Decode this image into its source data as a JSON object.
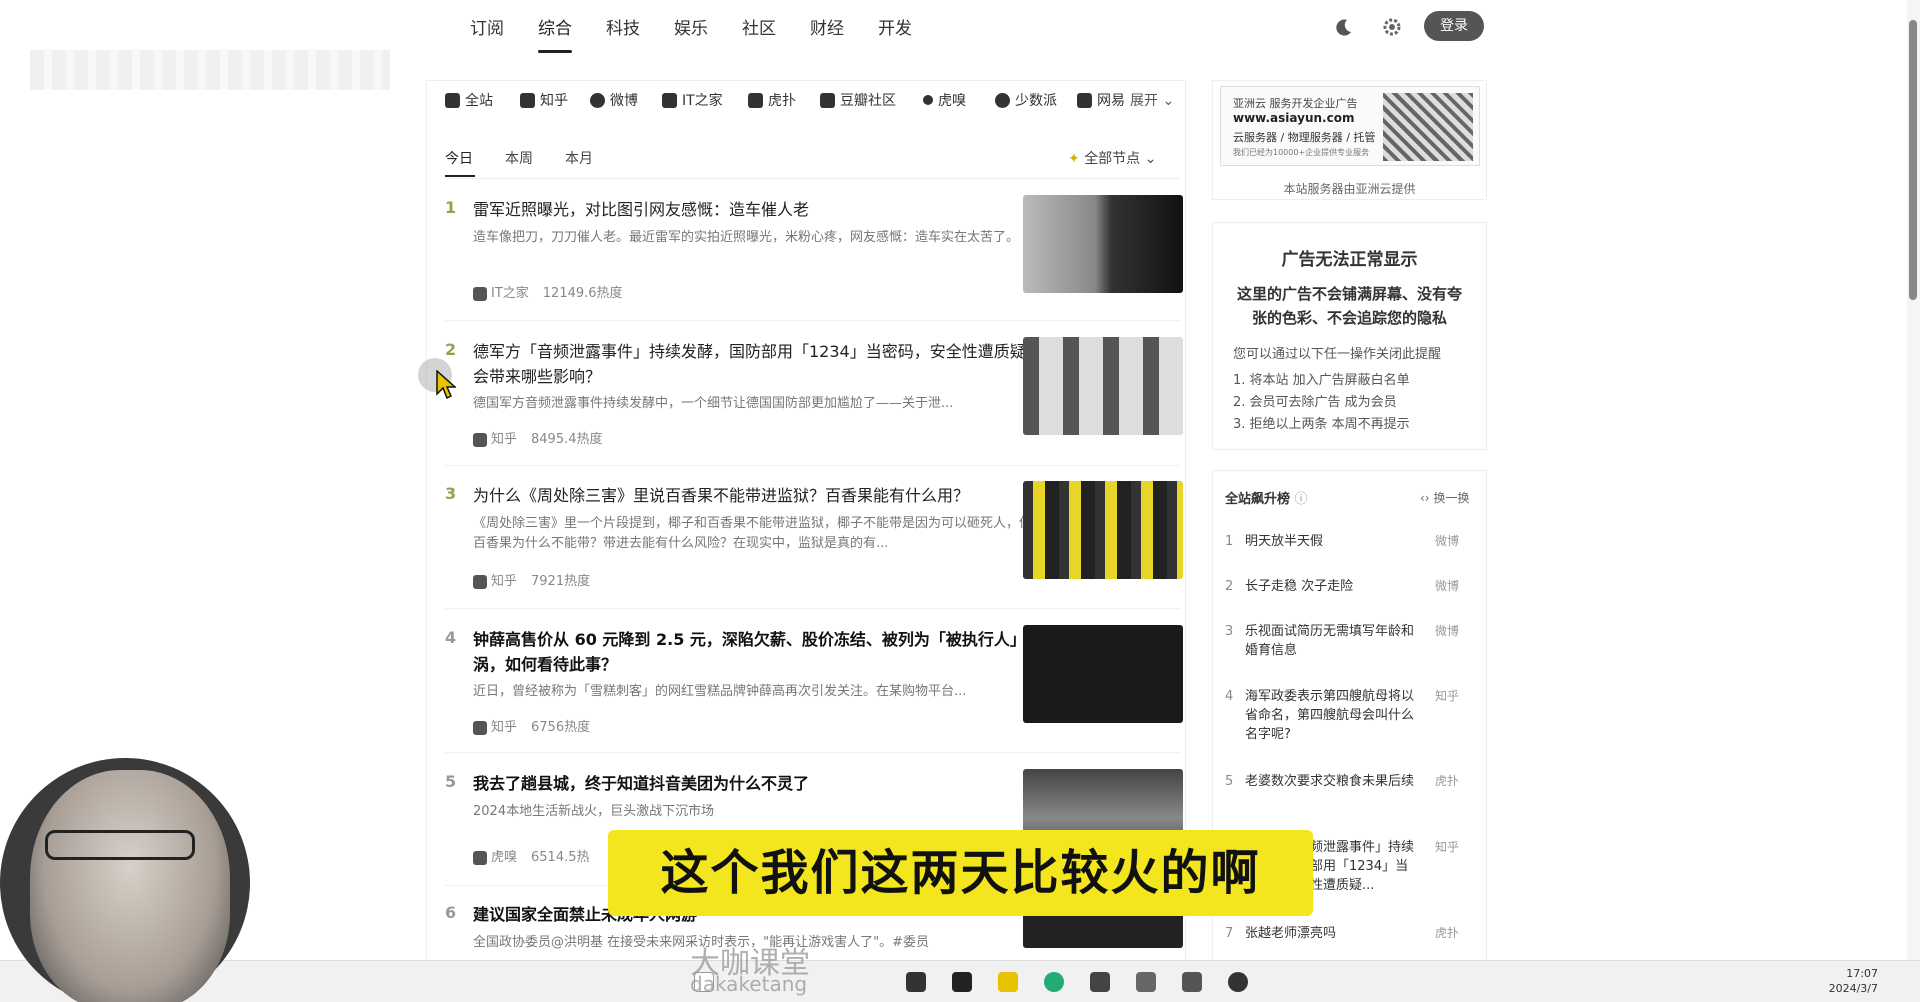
{
  "nav": {
    "tabs": [
      "订阅",
      "综合",
      "科技",
      "娱乐",
      "社区",
      "财经",
      "开发"
    ],
    "active_tab": "综合",
    "login_label": "登录"
  },
  "sources": {
    "items": [
      "全站",
      "知乎",
      "微博",
      "IT之家",
      "虎扑",
      "豆瓣社区",
      "虎嗅",
      "少数派",
      "网易"
    ],
    "expand_label": "展开"
  },
  "subtabs": {
    "items": [
      "今日",
      "本周",
      "本月"
    ],
    "active": "今日",
    "all_nodes_label": "全部节点"
  },
  "feed": [
    {
      "rank": "1",
      "title": "雷军近照曝光，对比图引网友感慨：造车催人老",
      "desc": "造车像把刀，刀刀催人老。最近雷军的实拍近照曝光，米粉心疼，网友感慨：造车实在太苦了。",
      "source": "IT之家",
      "heat": "12149.6热度"
    },
    {
      "rank": "2",
      "title": "德军方「音频泄露事件」持续发酵，国防部用「1234」当密码，安全性遭质疑，会带来哪些影响？",
      "desc": "德国军方音频泄露事件持续发酵中，一个细节让德国国防部更加尴尬了——关于泄...",
      "source": "知乎",
      "heat": "8495.4热度"
    },
    {
      "rank": "3",
      "title": "为什么《周处除三害》里说百香果不能带进监狱？百香果能有什么用？",
      "desc": "《周处除三害》里一个片段提到，椰子和百香果不能带进监狱，椰子不能带是因为可以砸死人，但百香果为什么不能带？带进去能有什么风险？在现实中，监狱是真的有...",
      "source": "知乎",
      "heat": "7921热度"
    },
    {
      "rank": "4",
      "title": "钟薛高售价从 60 元降到 2.5 元，深陷欠薪、股价冻结、被列为「被执行人」旋涡，如何看待此事？",
      "desc": "近日，曾经被称为「雪糕刺客」的网红雪糕品牌钟薛高再次引发关注。在某购物平台...",
      "source": "知乎",
      "heat": "6756热度"
    },
    {
      "rank": "5",
      "title": "我去了趟县城，终于知道抖音美团为什么不灵了",
      "desc": "2024本地生活新战火，巨头激战下沉市场",
      "source": "虎嗅",
      "heat": "6514.5热"
    },
    {
      "rank": "6",
      "title": "建议国家全面禁止未成年人网游",
      "desc": "全国政协委员@洪明基 在接受未来网采访时表示，\"能再让游戏害人了\"。#委员",
      "source": "",
      "heat": ""
    }
  ],
  "ad": {
    "line1": "亚洲云 服务开发企业广告",
    "line2": "www.asiayun.com",
    "line3": "云服务器 / 物理服务器 / 托管",
    "line4": "我们已经为10000+企业提供专业服务",
    "caption": "本站服务器由亚洲云提供"
  },
  "adblock": {
    "title": "广告无法正常显示",
    "subtitle": "这里的广告不会铺满屏幕、没有夸张的色彩、不会追踪您的隐私",
    "hint": "您可以通过以下任一操作关闭此提醒",
    "options": [
      "1. 将本站 加入广告屏蔽白名单",
      "2. 会员可去除广告 成为会员",
      "3. 拒绝以上两条 本周不再提示"
    ]
  },
  "ranking": {
    "title": "全站飙升榜",
    "swap_label": "换一换",
    "items": [
      {
        "n": "1",
        "t": "明天放半天假",
        "s": "微博"
      },
      {
        "n": "2",
        "t": "长子走稳 次子走险",
        "s": "微博"
      },
      {
        "n": "3",
        "t": "乐视面试简历无需填写年龄和婚育信息",
        "s": "微博"
      },
      {
        "n": "4",
        "t": "海军政委表示第四艘航母将以省命名，第四艘航母会叫什么名字呢?",
        "s": "知乎"
      },
      {
        "n": "5",
        "t": "老婆数次要求交粮食未果后续",
        "s": "虎扑"
      },
      {
        "n": "6",
        "t": "德军方「音频泄露事件」持续发酵，国防部用「1234」当密码，安全性遭质疑...",
        "s": "知乎"
      },
      {
        "n": "7",
        "t": "张越老师漂亮吗",
        "s": "虎扑"
      }
    ]
  },
  "overlay": {
    "subtitle": "这个我们这两天比较火的啊",
    "watermark_cn": "大咖课堂",
    "watermark_en": "dakaketang"
  },
  "taskbar": {
    "time": "17:07",
    "date": "2024/3/7"
  }
}
